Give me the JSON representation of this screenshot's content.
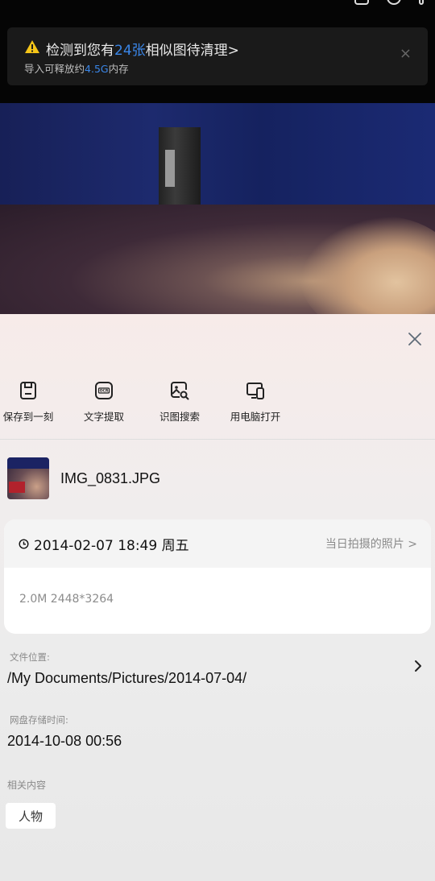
{
  "notice": {
    "title_pre": "检测到您有",
    "title_count": "24张",
    "title_post": "相似图待清理>",
    "sub_pre": "导入可释放约",
    "sub_size": "4.5G",
    "sub_post": "内存",
    "close_glyph": "×"
  },
  "actions": [
    {
      "label": "保存到一刻",
      "icon": "save-icon"
    },
    {
      "label": "文字提取",
      "icon": "ocr-icon"
    },
    {
      "label": "识图搜索",
      "icon": "image-search-icon"
    },
    {
      "label": "用电脑打开",
      "icon": "computer-icon"
    }
  ],
  "file": {
    "name": "IMG_0831.JPG"
  },
  "info_card": {
    "datetime": "2014-02-07 18:49 周五",
    "same_day_link": "当日拍摄的照片 >",
    "meta": "2.0M 2448*3264"
  },
  "location": {
    "label": "文件位置:",
    "path": "/My Documents/Pictures/2014-07-04/"
  },
  "storage_time": {
    "label": "网盘存储时间:",
    "value": "2014-10-08 00:56"
  },
  "related": {
    "label": "相关内容",
    "tags": [
      "人物"
    ]
  },
  "colors": {
    "accent": "#3a86e8",
    "warning": "#f5c518"
  }
}
